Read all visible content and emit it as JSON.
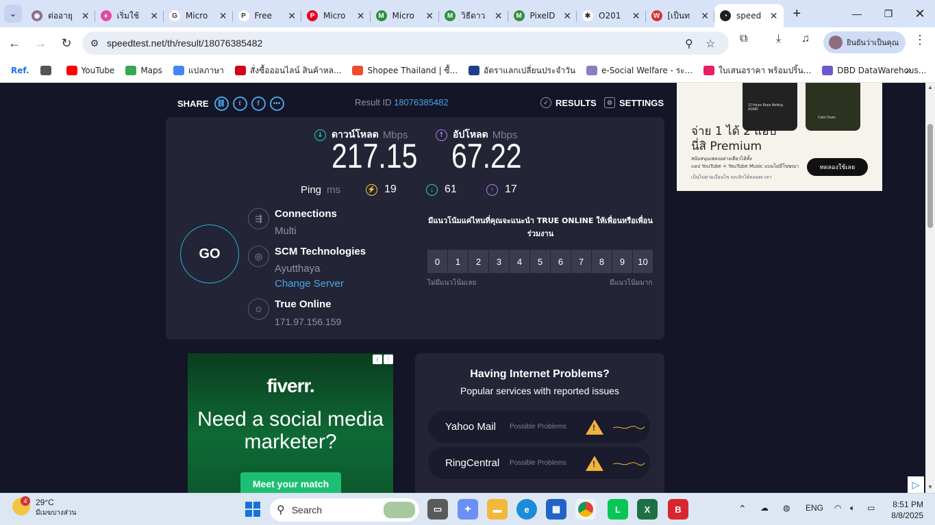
{
  "browser": {
    "tabs": [
      {
        "title": "ต่ออายุ",
        "fav_color": "#8a6f8c",
        "fav_glyph": "◉"
      },
      {
        "title": "เริ่มใช้",
        "fav_color": "#e24aa6",
        "fav_glyph": "♦"
      },
      {
        "title": "Micro",
        "fav_color": "#ffffff",
        "fav_glyph": "G"
      },
      {
        "title": "Free",
        "fav_color": "#ffffff",
        "fav_glyph": "P"
      },
      {
        "title": "Micro",
        "fav_color": "#e60023",
        "fav_glyph": "P"
      },
      {
        "title": "Micro",
        "fav_color": "#2f8f3f",
        "fav_glyph": "M"
      },
      {
        "title": "วิธีดาว",
        "fav_color": "#2f8f3f",
        "fav_glyph": "M"
      },
      {
        "title": "PixelD",
        "fav_color": "#2f8f3f",
        "fav_glyph": "M"
      },
      {
        "title": "O201",
        "fav_color": "#ffffff",
        "fav_glyph": "✱"
      },
      {
        "title": "[เป็นท",
        "fav_color": "#d63031",
        "fav_glyph": "W"
      },
      {
        "title": "speed",
        "fav_color": "#1f1f1f",
        "fav_glyph": "◔"
      }
    ],
    "url": "speedtest.net/th/result/18076385482",
    "profile_label": "ยินยันว่าเป็นคุณ",
    "bookmarks": [
      {
        "label": "Ref.",
        "color": "#1a73e8"
      },
      {
        "label": "",
        "color": "#555555"
      },
      {
        "label": "YouTube",
        "color": "#ff0000"
      },
      {
        "label": "Maps",
        "color": "#34a853"
      },
      {
        "label": "แปลภาษา",
        "color": "#4285f4"
      },
      {
        "label": "สั่งซื้อออนไลน์ สินค้าหล...",
        "color": "#d0021b"
      },
      {
        "label": "Shopee Thailand | ซื้...",
        "color": "#ee4d2d"
      },
      {
        "label": "อัตราแลกเปลี่ยนประจำวัน",
        "color": "#1b3f8b"
      },
      {
        "label": "e-Social Welfare - ระ...",
        "color": "#8e7cc3"
      },
      {
        "label": "ใบเสนอราคา พร้อมปริ้น...",
        "color": "#e91e63"
      },
      {
        "label": "DBD DataWarehous...",
        "color": "#6a5acd"
      }
    ]
  },
  "speedtest": {
    "share_label": "SHARE",
    "result_label": "Result ID",
    "result_id": "18076385482",
    "results_label": "RESULTS",
    "settings_label": "SETTINGS",
    "download_label": "ดาวน์โหลด",
    "upload_label": "อัปโหลด",
    "unit": "Mbps",
    "download_value": "217.15",
    "upload_value": "67.22",
    "ping_label": "Ping",
    "ping_unit": "ms",
    "ping_value": "19",
    "ping_down": "61",
    "ping_up": "17",
    "go_label": "GO",
    "connections_label": "Connections",
    "connections_value": "Multi",
    "server_name": "SCM Technologies",
    "server_location": "Ayutthaya",
    "change_server": "Change Server",
    "isp_name": "True Online",
    "isp_ip": "171.97.156.159",
    "question": "มีแนวโน้มแค่ไหนที่คุณจะแนะนำ TRUE ONLINE ให้เพื่อนหรือเพื่อนร่วมงาน",
    "ratings": [
      "0",
      "1",
      "2",
      "3",
      "4",
      "5",
      "6",
      "7",
      "8",
      "9",
      "10"
    ],
    "rating_low": "ไม่มีแนวโน้มเลย",
    "rating_high": "มีแนวโน้มมาก"
  },
  "ads": {
    "right_title_1": "จ่าย 1 ได้ 2 แอป",
    "right_title_2": "นี่สิ Premium",
    "right_small_1": "สนับสนุนเพลงอย่างเดียวได้ทั้ง",
    "right_small_2": "แอป YouTube + YouTube Music แบบไม่มีโฆษณา",
    "right_small_3": "เป็นไปตามเงื่อนไข ยกเลิกได้ตลอดเวลา",
    "right_button": "ทดลองใช้เลย",
    "phone_caption_1": "12 Hours Brain Melting ASMR",
    "phone_caption_2": "Calm Down",
    "fiverr_logo": "fiverr.",
    "fiverr_headline": "Need a social media marketer?",
    "fiverr_button": "Meet your match"
  },
  "problems": {
    "title": "Having Internet Problems?",
    "subtitle": "Popular services with reported issues",
    "items": [
      {
        "name": "Yahoo Mail",
        "status": "Possible Problems"
      },
      {
        "name": "RingCentral",
        "status": "Possible Problems"
      }
    ],
    "warning_color": "#f2b33d"
  },
  "taskbar": {
    "weather_temp": "29°C",
    "weather_desc": "มีเมฆบางส่วน",
    "weather_badge": "4",
    "search_placeholder": "Search",
    "language": "ENG",
    "time": "8:51 PM",
    "date": "8/8/2025"
  },
  "colors": {
    "accent": "#4aa6e6",
    "go_ring": "#23b5d3",
    "download_arrow": "#23d3c3",
    "upload_arrow": "#b67be8",
    "ping_icon": "#f2c94c"
  }
}
